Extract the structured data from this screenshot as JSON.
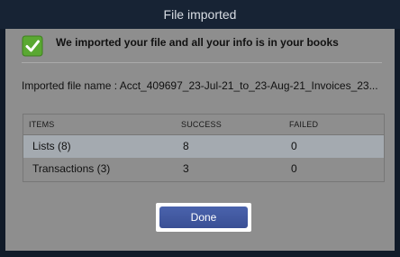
{
  "dialog": {
    "title": "File imported",
    "banner": {
      "icon": "check-icon",
      "message": "We imported your file and all your info is in your books"
    },
    "file": {
      "text": "Imported file name : Acct_409697_23-Jul-21_to_23-Aug-21_Invoices_23..."
    },
    "table": {
      "headers": [
        "ITEMS",
        "SUCCESS",
        "FAILED"
      ],
      "rows": [
        {
          "item": "Lists (8)",
          "success": "8",
          "failed": "0"
        },
        {
          "item": "Transactions (3)",
          "success": "3",
          "failed": "0"
        }
      ]
    },
    "done_label": "Done"
  },
  "colors": {
    "accent": "#3f55a0",
    "check_green": "#5aa832"
  }
}
